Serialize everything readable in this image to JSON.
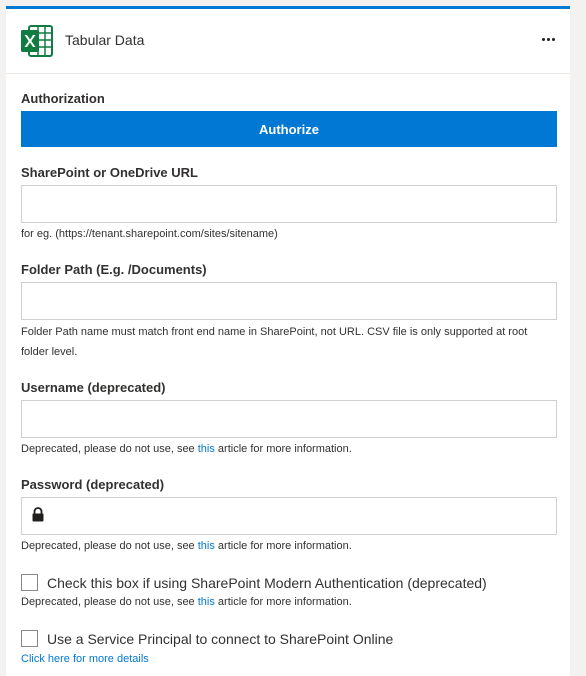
{
  "header": {
    "title": "Tabular Data",
    "icon": "excel-icon",
    "more": "more-options-icon"
  },
  "authorization": {
    "label": "Authorization",
    "button_label": "Authorize"
  },
  "sharepoint_url": {
    "label": "SharePoint or OneDrive URL",
    "value": "",
    "help": "for eg. (https://tenant.sharepoint.com/sites/sitename)"
  },
  "folder_path": {
    "label": "Folder Path (E.g. /Documents)",
    "value": "",
    "help": "Folder Path name must match front end name in SharePoint, not URL. CSV file is only supported at root folder level."
  },
  "username": {
    "label": "Username (deprecated)",
    "value": "",
    "help_before": "Deprecated, please do not use, see ",
    "help_link": "this",
    "help_after": " article for more information."
  },
  "password": {
    "label": "Password (deprecated)",
    "value": "",
    "icon": "lock-icon",
    "help_before": "Deprecated, please do not use, see ",
    "help_link": "this",
    "help_after": " article for more information."
  },
  "modern_auth": {
    "label": "Check this box if using SharePoint Modern Authentication (deprecated)",
    "checked": false,
    "help_before": "Deprecated, please do not use, see ",
    "help_link": "this",
    "help_after": " article for more information."
  },
  "service_principal": {
    "label": "Use a Service Principal to connect to SharePoint Online",
    "checked": false,
    "link": "Click here for more details"
  },
  "colors": {
    "accent": "#0078d4",
    "excel_green": "#107c41"
  }
}
